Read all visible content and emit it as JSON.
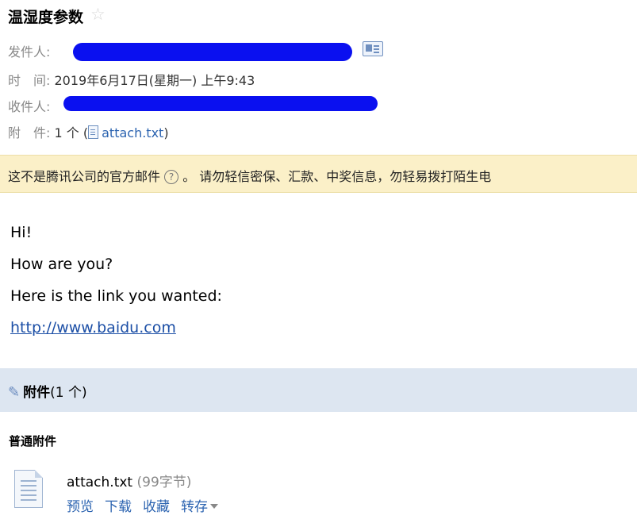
{
  "email": {
    "subject": "温湿度参数",
    "star_icon": "star-outline-icon",
    "sender_label": "发件人:",
    "time_label": "时　间:",
    "time_value": "2019年6月17日(星期一) 上午9:43",
    "recipient_label": "收件人:",
    "attachment_label": "附　件:",
    "attachment_count": "1 个",
    "attachment_open_paren": "(",
    "attachment_filename": "attach.txt",
    "attachment_close_paren": ")"
  },
  "warning": {
    "text_a": "这不是腾讯公司的官方邮件",
    "help_icon": "?",
    "text_b": "。  请勿轻信密保、汇款、中奖信息，勿轻易拨打陌生电"
  },
  "body": {
    "line1": "Hi!",
    "line2": "How are you?",
    "line3": "Here is the link you wanted:",
    "link": "http://www.baidu.com"
  },
  "attachments": {
    "title": "附件",
    "count": "(1 个)",
    "section_title": "普通附件",
    "file": {
      "name": "attach.txt",
      "size": "(99字节)",
      "actions": [
        "预览",
        "下载",
        "收藏",
        "转存"
      ]
    }
  },
  "colors": {
    "redaction": "#0a10f0",
    "link": "#2b63b0",
    "warning_bg": "#fbf0c8",
    "attach_bar_bg": "#dde6f1"
  }
}
